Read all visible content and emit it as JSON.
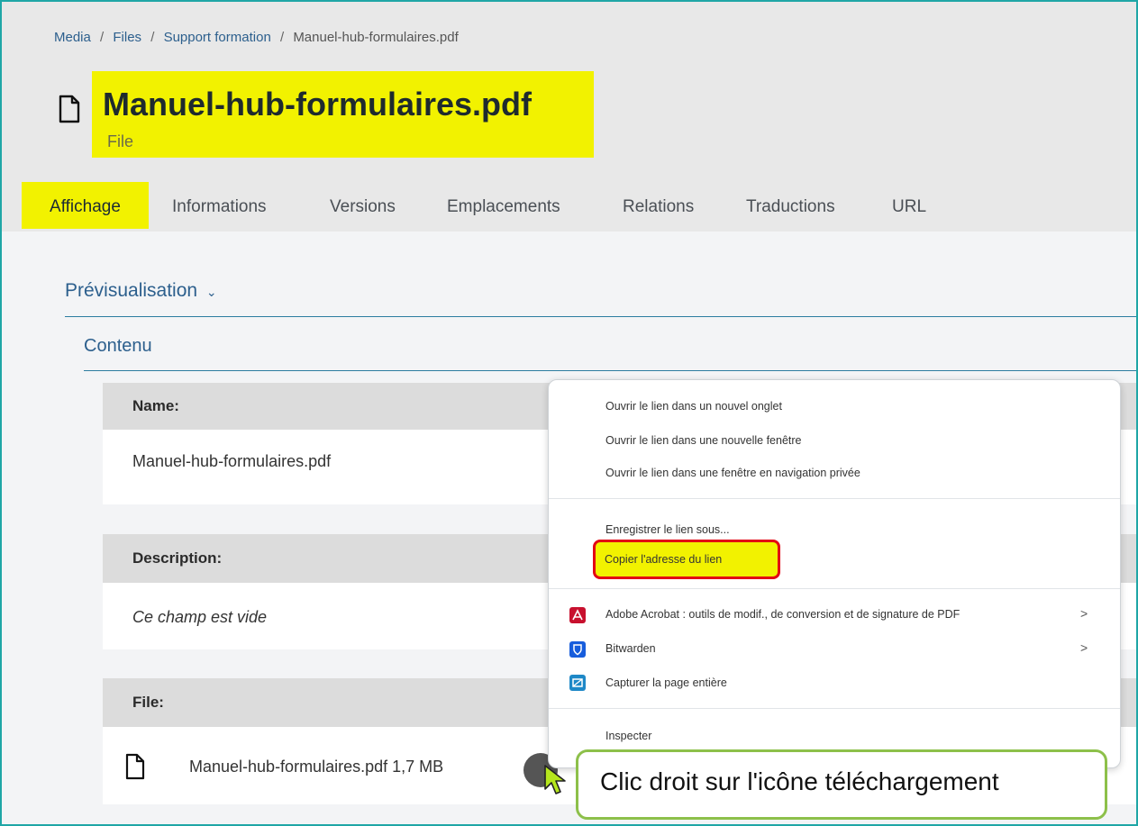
{
  "breadcrumb": {
    "items": [
      "Media",
      "Files",
      "Support formation",
      "Manuel-hub-formulaires.pdf"
    ],
    "separator": "/"
  },
  "page": {
    "title": "Manuel-hub-formulaires.pdf",
    "subtitle": "File"
  },
  "tabs": [
    {
      "label": "Affichage",
      "active": true
    },
    {
      "label": "Informations"
    },
    {
      "label": "Versions"
    },
    {
      "label": "Emplacements"
    },
    {
      "label": "Relations"
    },
    {
      "label": "Traductions"
    },
    {
      "label": "URL"
    }
  ],
  "sections": {
    "preview_label": "Prévisualisation",
    "content_label": "Contenu"
  },
  "fields": {
    "name": {
      "label": "Name:",
      "value": "Manuel-hub-formulaires.pdf"
    },
    "description": {
      "label": "Description:",
      "value": "Ce champ est vide"
    },
    "file": {
      "label": "File:",
      "value": "Manuel-hub-formulaires.pdf 1,7 MB"
    }
  },
  "context_menu": {
    "items": [
      "Ouvrir le lien dans un nouvel onglet",
      "Ouvrir le lien dans une nouvelle fenêtre",
      "Ouvrir le lien dans une fenêtre en navigation privée",
      "Enregistrer le lien sous...",
      "Copier l'adresse du lien",
      "Adobe Acrobat : outils de modif., de conversion et de signature de PDF",
      "Bitwarden",
      "Capturer la page entière",
      "Inspecter"
    ],
    "submenu_arrow": ">"
  },
  "callout": {
    "text": "Clic droit sur l'icône  téléchargement"
  },
  "colors": {
    "highlight": "#f2f200",
    "accent": "#2c5f8d",
    "callout_border": "#8dc04a",
    "red_box": "#e30613"
  }
}
